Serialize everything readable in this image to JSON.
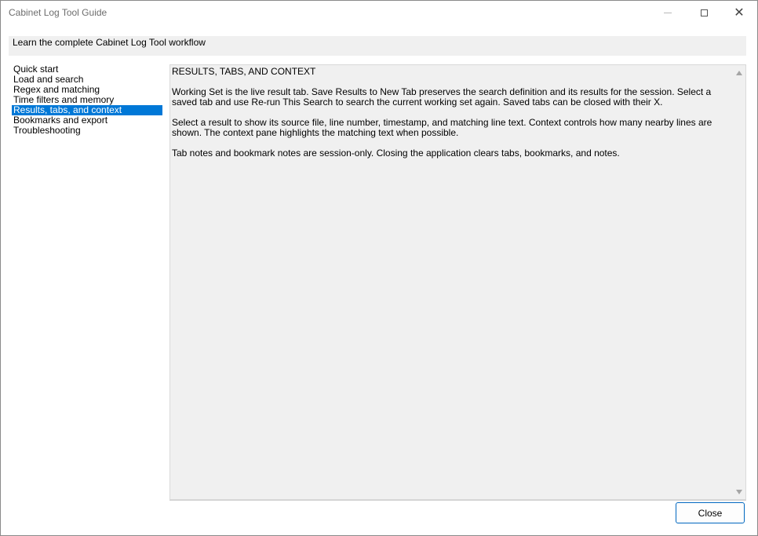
{
  "window": {
    "title": "Cabinet Log Tool Guide",
    "controls": {
      "minimize": "minimize-icon",
      "maximize": "maximize-icon",
      "close": "close-icon"
    }
  },
  "header": {
    "text": "Learn the complete Cabinet Log Tool workflow"
  },
  "topics": {
    "selected_index": 4,
    "items": [
      {
        "label": "Quick start"
      },
      {
        "label": "Load and search"
      },
      {
        "label": "Regex and matching"
      },
      {
        "label": "Time filters and memory"
      },
      {
        "label": "Results, tabs, and context"
      },
      {
        "label": "Bookmarks and export"
      },
      {
        "label": "Troubleshooting"
      }
    ]
  },
  "content": {
    "heading": "RESULTS, TABS, AND CONTEXT",
    "paragraphs": [
      "Working Set is the live result tab. Save Results to New Tab preserves the search definition and its results for the session. Select a saved tab and use Re-run This Search to search the current working set again. Saved tabs can be closed with their X.",
      "Select a result to show its source file, line number, timestamp, and matching line text. Context controls how many nearby lines are shown. The context pane highlights the matching text when possible.",
      "Tab notes and bookmark notes are session-only. Closing the application clears tabs, bookmarks, and notes."
    ]
  },
  "footer": {
    "close_label": "Close"
  },
  "colors": {
    "selection": "#0078d7",
    "accent_border": "#0067c0",
    "panel_background": "#f0f0f0"
  }
}
